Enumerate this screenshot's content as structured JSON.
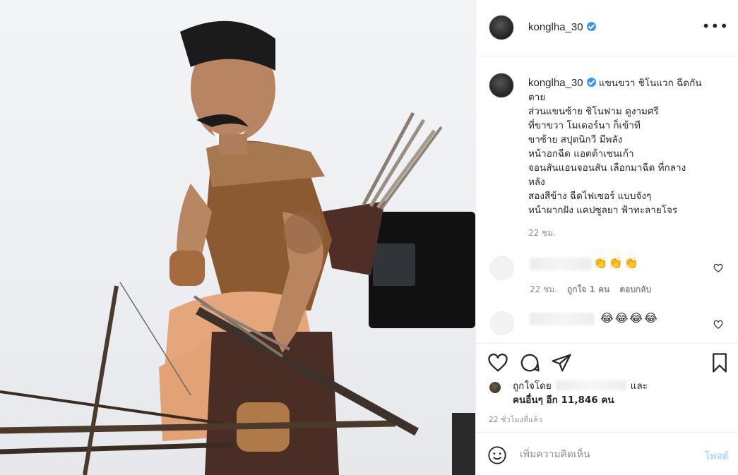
{
  "post": {
    "username": "konglha_30",
    "caption_lines": [
      "แขนขวา ชิโนแวก ฉีดกัน",
      "ตาย",
      "ส่วนแขนซ้าย ชิโนฟาม ดูงามศรี",
      "ที่ขาขวา โมเดอร์นา ก็เข้าที",
      "ขาซ้าย สปุตนิกวี มีพลัง",
      "หน้าอกฉีด แอตต้าเซนเก้า",
      "จอนสันแอนจอนสัน เลือกมาฉีด ที่กลาง",
      "หลัง",
      "สองสีข้าง ฉีดไฟเซอร์ แบบจังๆ",
      "หน้าผากฝัง แคปซูลยา ฟ้าทะลายโจร"
    ],
    "caption_time": "22 ชม."
  },
  "comments": [
    {
      "emoji": "👏👏👏",
      "time": "22 ชม.",
      "likes": "ถูกใจ 1 คน",
      "reply": "ตอบกลับ"
    },
    {
      "emoji": "😂😂😂😂"
    }
  ],
  "likes": {
    "prefix": "ถูกใจโดย",
    "suffix": "และ",
    "others": "คนอื่นๆ อีก 11,846 คน"
  },
  "post_time": "22 ชั่วโมงที่แล้ว",
  "comment_box": {
    "placeholder": "เพิ่มความคิดเห็น",
    "post_label": "โพสต์"
  },
  "icons": {
    "like": "heart-icon",
    "comment": "speech-bubble-icon",
    "share": "paper-plane-icon",
    "save": "bookmark-icon",
    "emoji": "smiley-icon",
    "more": "ellipsis-icon"
  },
  "colors": {
    "verified": "#3897f0",
    "post_button": "#b3dbff",
    "muted": "#8e8e8e",
    "text": "#262626"
  }
}
